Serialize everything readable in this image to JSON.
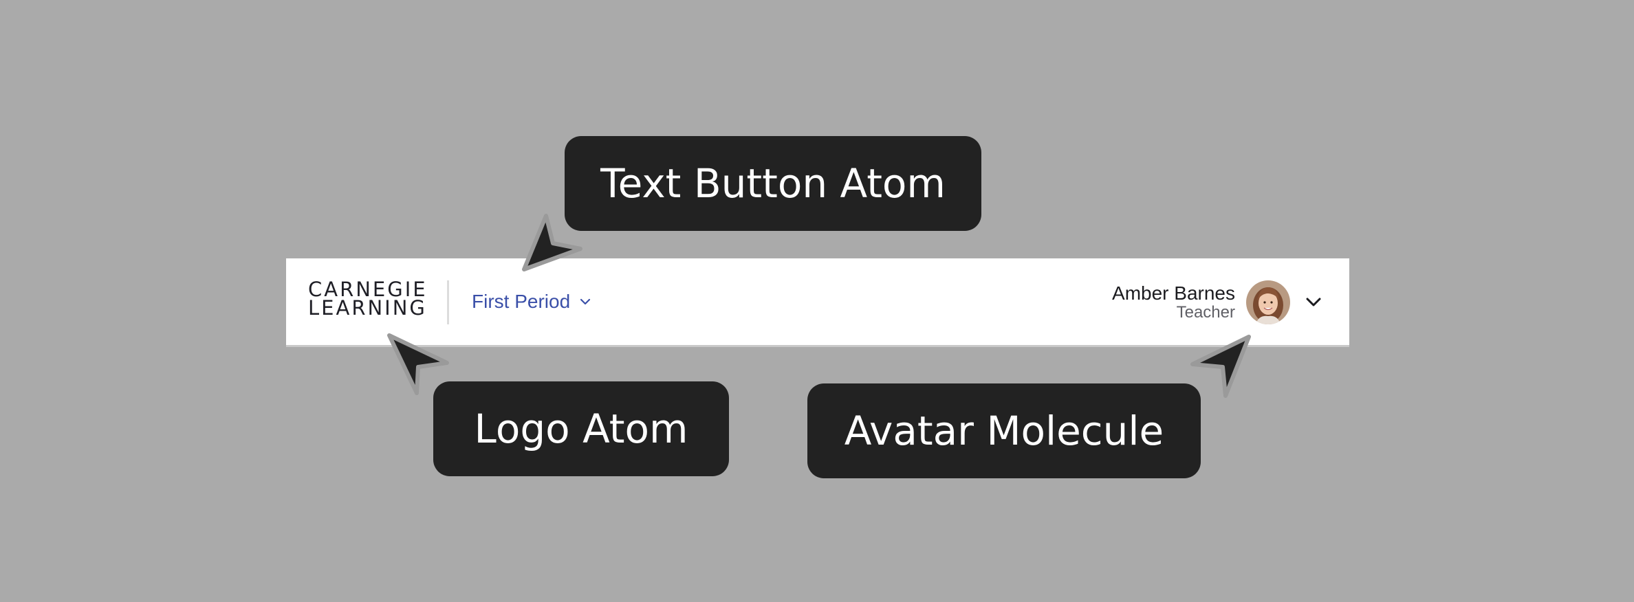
{
  "header": {
    "logo": {
      "line1": "CARNEGIE",
      "line2": "LEARNING"
    },
    "period_selector": {
      "label": "First Period",
      "icon": "chevron-down-icon"
    },
    "user": {
      "name": "Amber Barnes",
      "role": "Teacher",
      "avatar_icon": "avatar-photo",
      "menu_icon": "chevron-down-icon"
    }
  },
  "annotations": {
    "text_button": "Text Button Atom",
    "logo": "Logo Atom",
    "avatar": "Avatar Molecule"
  },
  "colors": {
    "background": "#aaaaaa",
    "header_bg": "#ffffff",
    "callout_bg": "#222222",
    "link_blue": "#3a4fa8",
    "text_dark": "#1b1b1f",
    "text_muted": "#606066"
  }
}
